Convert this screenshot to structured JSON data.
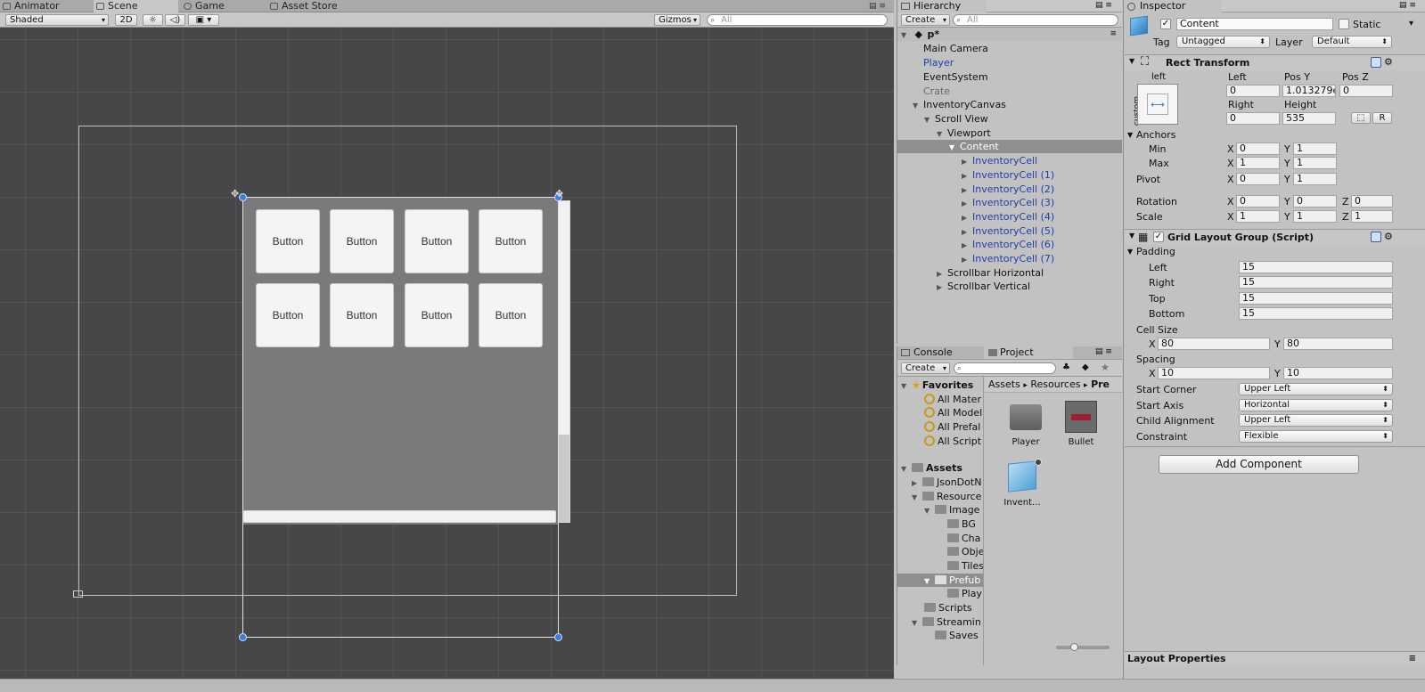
{
  "scene_panel": {
    "tabs": [
      "Animator",
      "Scene",
      "Game",
      "Asset Store"
    ],
    "toolbar": {
      "shading_mode": "Shaded",
      "mode_2d": "2D",
      "gizmos_label": "Gizmos",
      "search_placeholder": "All"
    },
    "buttons": [
      "Button",
      "Button",
      "Button",
      "Button",
      "Button",
      "Button",
      "Button",
      "Button"
    ]
  },
  "hierarchy": {
    "tab_label": "Hierarchy",
    "create_label": "Create",
    "search_placeholder": "All",
    "scene_name": "p*",
    "items": [
      {
        "label": "Main Camera"
      },
      {
        "label": "Player"
      },
      {
        "label": "EventSystem"
      },
      {
        "label": "Crate"
      },
      {
        "label": "InventoryCanvas"
      },
      {
        "label": "Scroll View"
      },
      {
        "label": "Viewport"
      },
      {
        "label": "Content"
      },
      {
        "label": "InventoryCell"
      },
      {
        "label": "InventoryCell (1)"
      },
      {
        "label": "InventoryCell (2)"
      },
      {
        "label": "InventoryCell (3)"
      },
      {
        "label": "InventoryCell (4)"
      },
      {
        "label": "InventoryCell (5)"
      },
      {
        "label": "InventoryCell (6)"
      },
      {
        "label": "InventoryCell (7)"
      },
      {
        "label": "Scrollbar Horizontal"
      },
      {
        "label": "Scrollbar Vertical"
      }
    ]
  },
  "project": {
    "tabs": [
      "Console",
      "Project"
    ],
    "create_label": "Create",
    "favorites_label": "Favorites",
    "favorites": [
      "All Mater",
      "All Model",
      "All Prefal",
      "All Script"
    ],
    "assets_label": "Assets",
    "tree": [
      "JsonDotN",
      "Resource",
      "Image",
      "BG",
      "Cha",
      "Obje",
      "Tiles",
      "Prefub",
      "Play",
      "Scripts",
      "Streamin",
      "Saves"
    ],
    "breadcrumb": [
      "Assets",
      "Resources",
      "Pre"
    ],
    "asset_items": [
      "Player",
      "Bullet",
      "Invent..."
    ]
  },
  "inspector": {
    "tab_label": "Inspector",
    "object_name": "Content",
    "static_label": "Static",
    "tag_label": "Tag",
    "tag_value": "Untagged",
    "layer_label": "Layer",
    "layer_value": "Default",
    "rect_transform": {
      "title": "Rect Transform",
      "anchor_preset_top": "left",
      "anchor_preset_side": "custom",
      "headers_row1": [
        "Left",
        "Pos Y",
        "Pos Z"
      ],
      "values_row1": [
        "0",
        "1.013279e",
        "0"
      ],
      "headers_row2": [
        "Right",
        "Height"
      ],
      "values_row2": [
        "0",
        "535"
      ],
      "r_button": "R",
      "anchors_label": "Anchors",
      "min_label": "Min",
      "min_x": "0",
      "min_y": "1",
      "max_label": "Max",
      "max_x": "1",
      "max_y": "1",
      "pivot_label": "Pivot",
      "pivot_x": "0",
      "pivot_y": "1",
      "rotation_label": "Rotation",
      "rotation": [
        "0",
        "0",
        "0"
      ],
      "scale_label": "Scale",
      "scale": [
        "1",
        "1",
        "1"
      ]
    },
    "grid_layout": {
      "title": "Grid Layout Group (Script)",
      "padding_label": "Padding",
      "left_label": "Left",
      "left": "15",
      "right_label": "Right",
      "right": "15",
      "top_label": "Top",
      "top": "15",
      "bottom_label": "Bottom",
      "bottom": "15",
      "cell_size_label": "Cell Size",
      "cell_x": "80",
      "cell_y": "80",
      "spacing_label": "Spacing",
      "spacing_x": "10",
      "spacing_y": "10",
      "start_corner_label": "Start Corner",
      "start_corner": "Upper Left",
      "start_axis_label": "Start Axis",
      "start_axis": "Horizontal",
      "child_alignment_label": "Child Alignment",
      "child_alignment": "Upper Left",
      "constraint_label": "Constraint",
      "constraint": "Flexible"
    },
    "add_component": "Add Component",
    "layout_properties": "Layout Properties"
  },
  "axis_letters": {
    "x": "X",
    "y": "Y",
    "z": "Z"
  }
}
